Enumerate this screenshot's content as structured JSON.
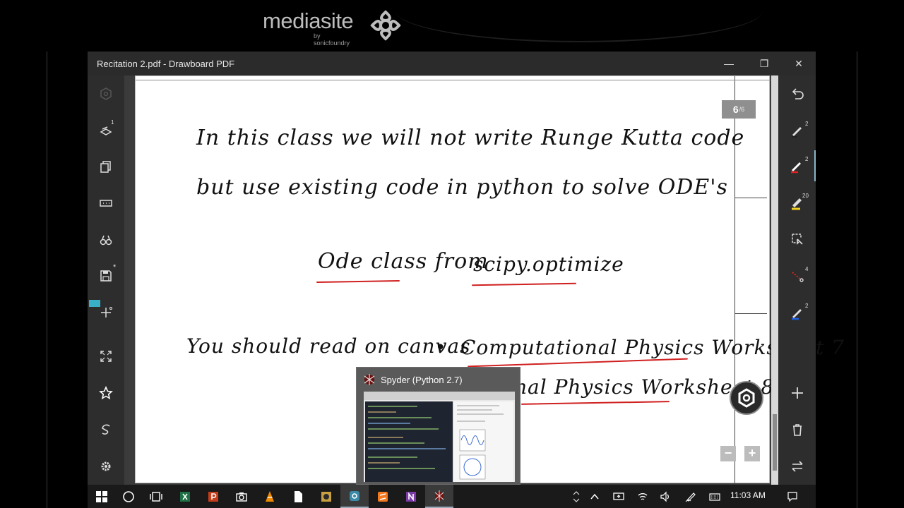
{
  "banner": {
    "brand": "mediasite",
    "byline": "by sonicfoundry"
  },
  "window": {
    "title": "Recitation 2.pdf - Drawboard PDF",
    "minimize": "—",
    "restore": "❐",
    "close": "✕"
  },
  "left_toolbar": {
    "layers_count": "1",
    "save_badge": "*"
  },
  "page": {
    "current": "6",
    "total": "/6",
    "lines": [
      "In this class we will not write Runge Kutta code",
      "but use existing code in python to solve ODE's",
      "Ode class from",
      "scipy.optimize",
      "You should read on canvas",
      "•",
      "Computational Physics Worksheet 7",
      "nal Physics Worksheet 8"
    ]
  },
  "right_toolbar": {
    "pen1_size": "2",
    "pen2_size": "2",
    "highlighter_size": "20",
    "dotted_size": "4",
    "pen3_size": "2",
    "accent_red": "#e02020",
    "accent_yellow": "#f0d020",
    "accent_blue": "#2060e0"
  },
  "zoom": {
    "minus": "−",
    "plus": "+"
  },
  "preview": {
    "title": "Spyder (Python 2.7)"
  },
  "taskbar": {
    "clock": "11:03 AM"
  }
}
